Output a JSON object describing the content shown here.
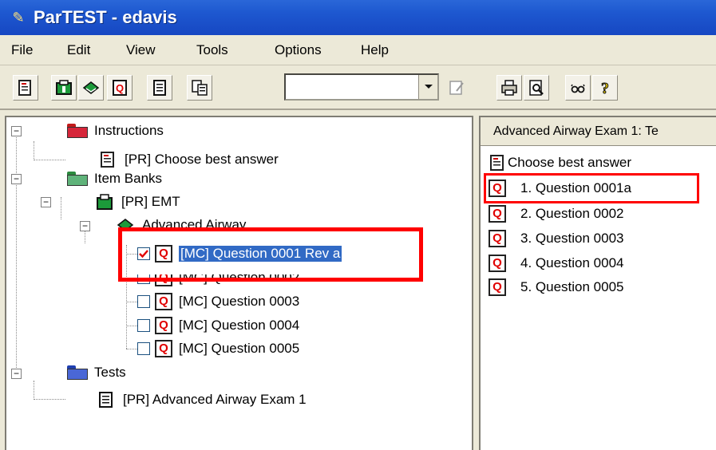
{
  "window": {
    "title": "ParTEST - edavis"
  },
  "menu": [
    "File",
    "Edit",
    "View",
    "Tools",
    "Options",
    "Help"
  ],
  "toolbar": {
    "combo_value": "",
    "icons": [
      "instructions-icon",
      "item-bank-icon",
      "book-icon",
      "question-icon",
      "document-icon",
      "copy-icon",
      "edit-icon",
      "print-icon",
      "preview-icon",
      "glasses-icon",
      "help-icon"
    ]
  },
  "tree": {
    "instructions": "Instructions",
    "choose_best": "[PR] Choose best answer",
    "item_banks": "Item Banks",
    "emt": "[PR] EMT",
    "advanced_airway": "Advanced Airway",
    "questions": [
      "[MC] Question 0001 Rev a",
      "[MC] Question 0002",
      "[MC] Question 0003",
      "[MC] Question 0004",
      "[MC] Question 0005"
    ],
    "tests": "Tests",
    "exam": "[PR] Advanced Airway Exam 1"
  },
  "right_pane": {
    "header": "Advanced Airway Exam 1: Te",
    "instruction": "Choose best answer",
    "questions": [
      "1. Question 0001a",
      "2. Question 0002",
      "3. Question 0003",
      "4. Question 0004",
      "5. Question 0005"
    ]
  },
  "colors": {
    "title_bar": "#1e58d0",
    "selection": "#316ac5",
    "annotation": "#ff0000",
    "question_glyph": "#e00000"
  }
}
